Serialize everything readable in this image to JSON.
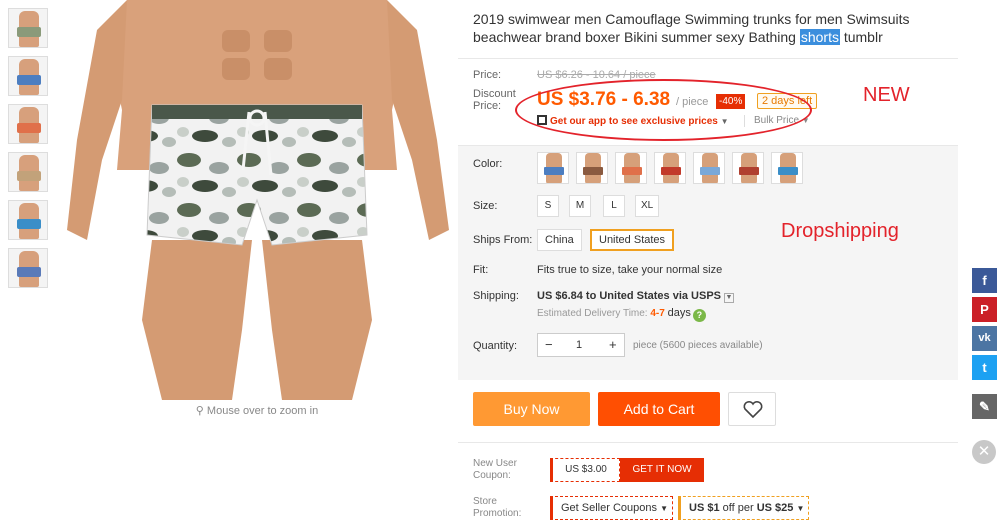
{
  "title": {
    "before": "2019 swimwear men Camouflage Swimming trunks for men Swimsuits beachwear brand boxer Bikini summer sexy Bathing ",
    "highlight": "shorts",
    "after": " tumblr"
  },
  "price": {
    "price_label": "Price:",
    "old_price": "US $6.26 - 10.64 / piece",
    "discount_label_1": "Discount",
    "discount_label_2": "Price:",
    "new_price": "US $3.76 - 6.38",
    "per_unit": "/ piece",
    "discount_badge": "-40%",
    "days_left": "2 days left",
    "app_promo": "Get our app to see exclusive prices",
    "bulk_price": "Bulk Price"
  },
  "annotations": {
    "new": "NEW",
    "dropshipping": "Dropshipping"
  },
  "options": {
    "color_label": "Color:",
    "size_label": "Size:",
    "sizes": [
      "S",
      "M",
      "L",
      "XL"
    ],
    "ships_from_label": "Ships From:",
    "ships_from": [
      "China",
      "United States"
    ],
    "fit_label": "Fit:",
    "fit_value": "Fits true to size, take your normal size",
    "shipping_label": "Shipping:",
    "shipping_value": "US $6.84 to United States via USPS",
    "eta_prefix": "Estimated Delivery Time:",
    "eta_days": "4-7",
    "eta_suffix": "days",
    "quantity_label": "Quantity:",
    "quantity_value": "1",
    "quantity_available": "piece (5600 pieces available)"
  },
  "actions": {
    "buy_now": "Buy Now",
    "add_to_cart": "Add to Cart"
  },
  "coupon": {
    "new_user_label_1": "New User",
    "new_user_label_2": "Coupon:",
    "amount": "US $3.00",
    "get_it": "GET IT NOW",
    "store_label_1": "Store",
    "store_label_2": "Promotion:",
    "seller_coupons": "Get Seller Coupons",
    "promo_strong_1": "US $1",
    "promo_mid": " off per ",
    "promo_strong_2": "US $25"
  },
  "zoom_hint": "Mouse over to zoom in",
  "social": [
    {
      "icon": "facebook-icon",
      "glyph": "f",
      "color": "#3b5998"
    },
    {
      "icon": "pinterest-icon",
      "glyph": "P",
      "color": "#cb2027"
    },
    {
      "icon": "vk-icon",
      "glyph": "vk",
      "color": "#4c75a3"
    },
    {
      "icon": "twitter-icon",
      "glyph": "t",
      "color": "#1da1f2"
    },
    {
      "icon": "edit-icon",
      "glyph": "✎",
      "color": "#666666"
    }
  ],
  "colors": {
    "accent": "#ff4f02",
    "buy": "#ff9933",
    "price": "#ff5a00",
    "annotation": "#e3232b"
  }
}
